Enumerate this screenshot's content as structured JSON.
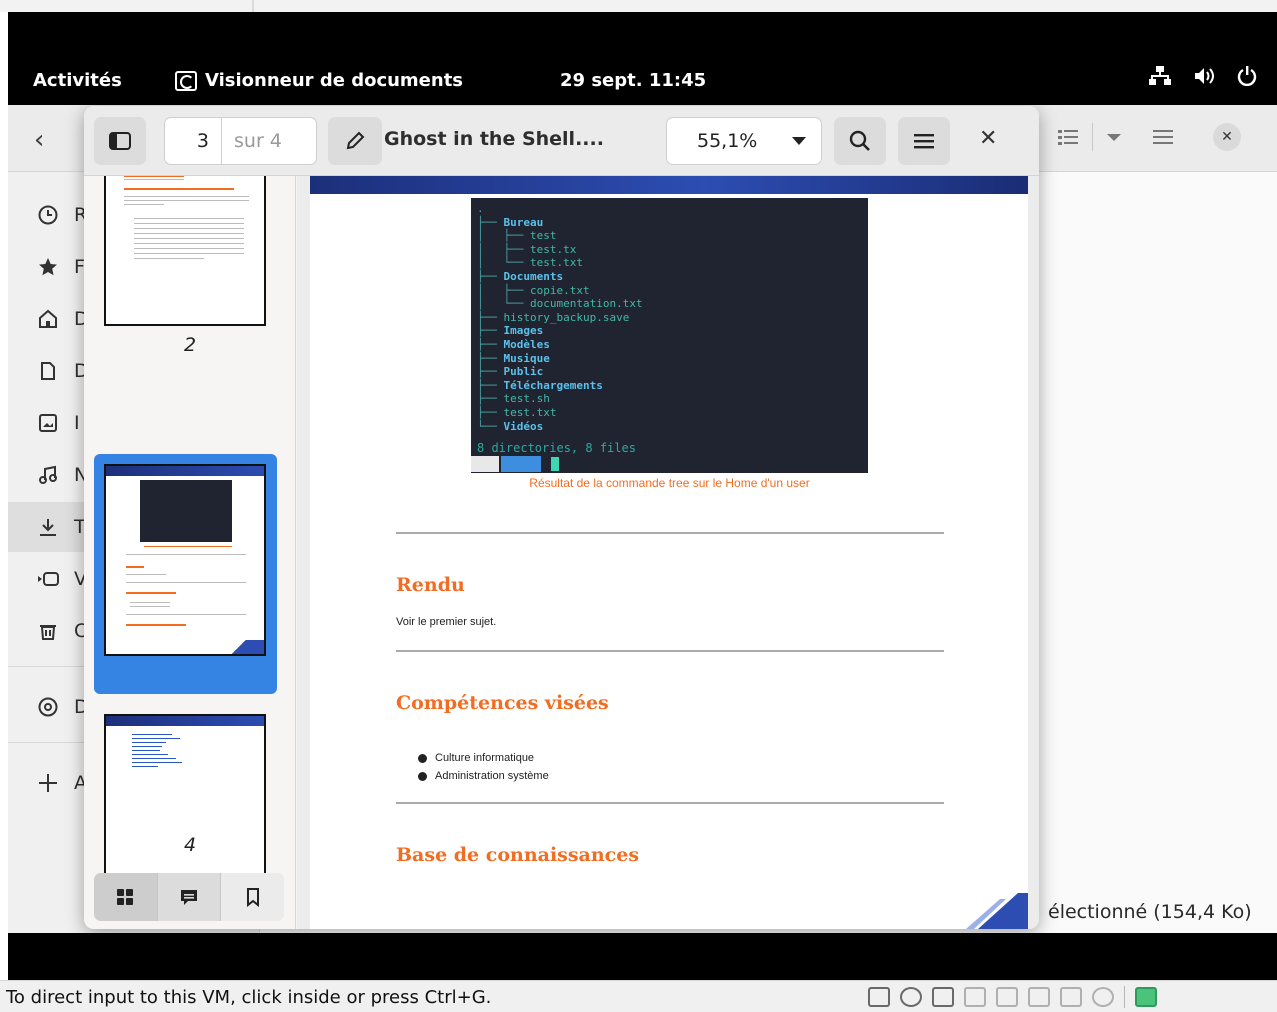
{
  "topbar": {
    "activities": "Activités",
    "app_name": "Visionneur de documents",
    "clock": "29 sept. 11:45",
    "tray_icons": [
      "network-icon",
      "volume-icon",
      "power-icon"
    ]
  },
  "files": {
    "status": "électionné (154,4 Ko)",
    "sidebar": [
      {
        "icon": "clock-icon",
        "label": "R"
      },
      {
        "icon": "star-icon",
        "label": "F"
      },
      {
        "icon": "home-icon",
        "label": "D"
      },
      {
        "icon": "document-icon",
        "label": "D"
      },
      {
        "icon": "image-icon",
        "label": "I"
      },
      {
        "icon": "music-icon",
        "label": "N"
      },
      {
        "icon": "download-icon",
        "label": "T"
      },
      {
        "icon": "video-icon",
        "label": "V"
      },
      {
        "icon": "trash-icon",
        "label": "C"
      },
      {
        "icon": "disc-icon",
        "label": "D"
      },
      {
        "icon": "plus-icon",
        "label": "A"
      }
    ]
  },
  "viewer": {
    "page_current": "3",
    "page_total": "sur 4",
    "title": "Ghost in the Shell....",
    "zoom": "55,1%",
    "thumb_labels": [
      "2",
      "3",
      "4"
    ]
  },
  "document": {
    "terminal_lines": [
      {
        "prefix": ".",
        "text": "",
        "kind": "tree"
      },
      {
        "prefix": "├── ",
        "text": "Bureau",
        "kind": "dir"
      },
      {
        "prefix": "│   ├── ",
        "text": "test",
        "kind": "file"
      },
      {
        "prefix": "│   ├── ",
        "text": "test.tx",
        "kind": "file"
      },
      {
        "prefix": "│   └── ",
        "text": "test.txt",
        "kind": "file"
      },
      {
        "prefix": "├── ",
        "text": "Documents",
        "kind": "dir"
      },
      {
        "prefix": "│   ├── ",
        "text": "copie.txt",
        "kind": "file"
      },
      {
        "prefix": "│   └── ",
        "text": "documentation.txt",
        "kind": "file"
      },
      {
        "prefix": "├── ",
        "text": "history_backup.save",
        "kind": "file"
      },
      {
        "prefix": "├── ",
        "text": "Images",
        "kind": "dir"
      },
      {
        "prefix": "├── ",
        "text": "Modèles",
        "kind": "dir"
      },
      {
        "prefix": "├── ",
        "text": "Musique",
        "kind": "dir"
      },
      {
        "prefix": "├── ",
        "text": "Public",
        "kind": "dir"
      },
      {
        "prefix": "├── ",
        "text": "Téléchargements",
        "kind": "dir"
      },
      {
        "prefix": "├── ",
        "text": "test.sh",
        "kind": "file"
      },
      {
        "prefix": "├── ",
        "text": "test.txt",
        "kind": "file"
      },
      {
        "prefix": "└── ",
        "text": "Vidéos",
        "kind": "dir"
      }
    ],
    "terminal_summary": "8 directories, 8 files",
    "caption": "Résultat de la commande tree sur le Home d'un user",
    "sections": {
      "rendu_title": "Rendu",
      "rendu_text": "Voir le premier sujet.",
      "competences_title": "Compétences visées",
      "competences": [
        "Culture informatique",
        "Administration système"
      ],
      "base_title": "Base de connaissances"
    }
  },
  "host": {
    "message": "To direct input to this VM, click inside or press Ctrl+G."
  }
}
